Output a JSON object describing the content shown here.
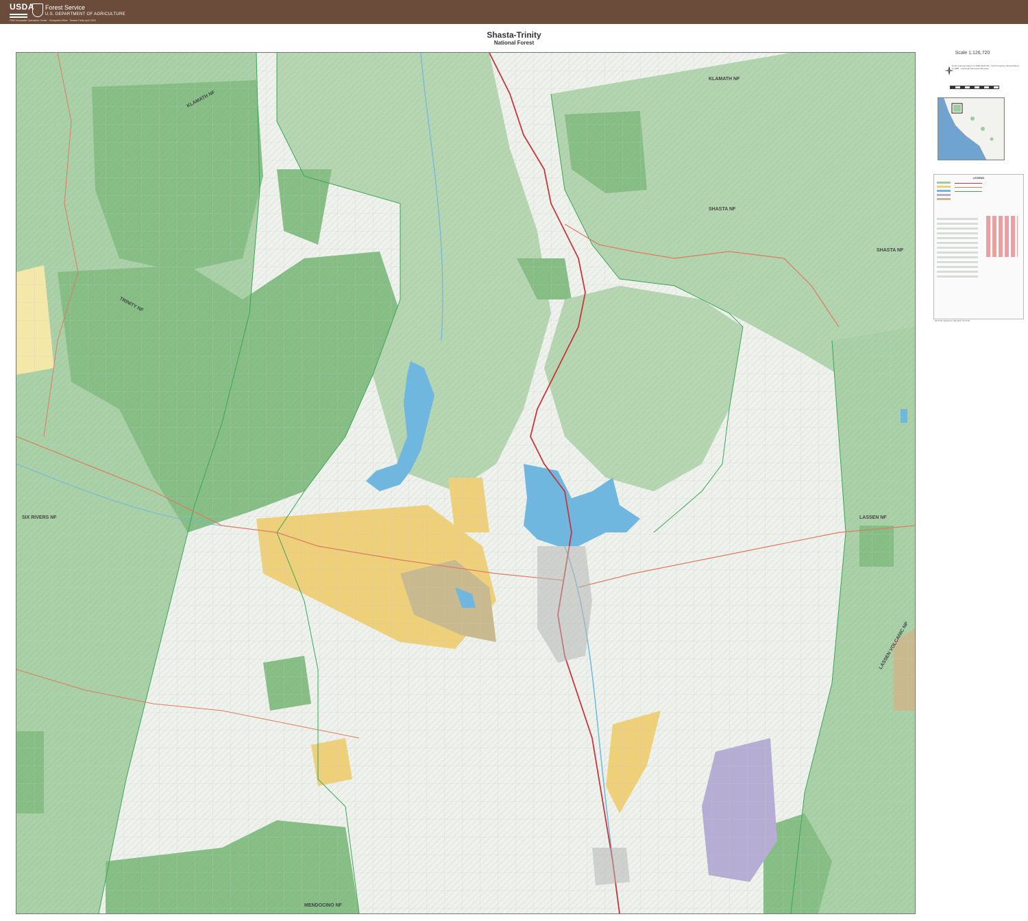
{
  "header": {
    "usda": "USDA",
    "agency": "Forest Service",
    "department": "U.S. DEPARTMENT OF AGRICULTURE",
    "credit": "FSM Geospatial Operations Center · Geospatial Office · Shasta-Trinity April 2023"
  },
  "title": {
    "main": "Shasta-Trinity",
    "sub": "National Forest"
  },
  "sidebar": {
    "scale": "Scale 1:126,720",
    "projection": "North American Datum of 1983 (NAD 83) · North American Vertical Datum of 1988 · Universal Transverse Mercator",
    "legend_heading": "LEGEND",
    "disclaimer_heading": "MOTOR VEHICLE USE MAP NOTICE"
  },
  "places": {
    "klamath_nf_w": "KLAMATH NF",
    "klamath_nf_e": "KLAMATH NF",
    "trinity_nf": "TRINITY NF",
    "shasta_nf_1": "SHASTA NF",
    "shasta_nf_2": "SHASTA NF",
    "six_rivers_nf": "SIX RIVERS NF",
    "lassen_nf": "LASSEN NF",
    "lassen_park": "LASSEN VOLCANIC NP",
    "mendocino_nf": "MENDOCINO NF"
  },
  "colors": {
    "forest": "#9fcc9e",
    "forest_dark": "#7fb57f",
    "private": "#eef0ec",
    "blm": "#eecf7a",
    "water": "#6fb7df",
    "wilderness": "#c9b98e",
    "other_federal": "#b5add3",
    "boundary": "#3aa657",
    "highway": "#c8343a",
    "header": "#6b4c3b"
  }
}
